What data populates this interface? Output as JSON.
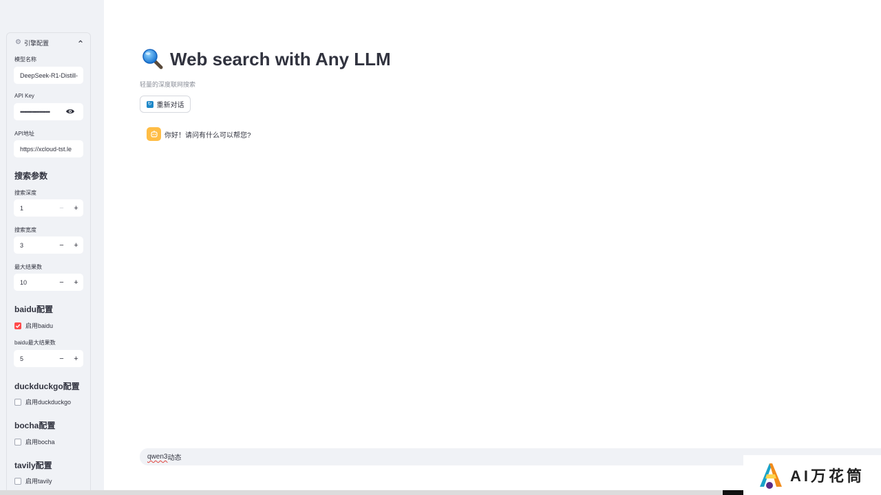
{
  "sidebar": {
    "engine_panel": {
      "title": "引擎配置",
      "model_label": "模型名称",
      "model_value": "DeepSeek-R1-Distill-",
      "api_key_label": "API Key",
      "api_key_value": "••••••••••••••••••••",
      "api_url_label": "API地址",
      "api_url_value": "https://xcloud-tst.le"
    },
    "search": {
      "heading": "搜索参数",
      "depth_label": "搜索深度",
      "depth_value": "1",
      "breadth_label": "搜索宽度",
      "breadth_value": "3",
      "max_results_label": "最大结果数",
      "max_results_value": "10"
    },
    "baidu": {
      "heading": "baidu配置",
      "enable_label": "启用baidu",
      "enabled": true,
      "max_label": "baidu最大结果数",
      "max_value": "5"
    },
    "duckduckgo": {
      "heading": "duckduckgo配置",
      "enable_label": "启用duckduckgo",
      "enabled": false
    },
    "bocha": {
      "heading": "bocha配置",
      "enable_label": "启用bocha",
      "enabled": false
    },
    "tavily": {
      "heading": "tavily配置",
      "enable_label": "启用tavily",
      "enabled": false
    },
    "stepper": {
      "minus": "−",
      "plus": "+"
    }
  },
  "main": {
    "title": "Web search with Any LLM",
    "subtitle": "轻量的深度联网搜索",
    "new_chat_label": "重新对话",
    "assistant_message": "你好！请问有什么可以帮您?",
    "input_value_typo": "qwen3",
    "input_value_rest": "动态"
  },
  "watermark": {
    "text": "AI万花筒"
  },
  "colors": {
    "sidebar_bg": "#f0f2f6",
    "accent_red": "#ff4b4b",
    "avatar_orange": "#ffbd45",
    "text": "#31333f"
  }
}
